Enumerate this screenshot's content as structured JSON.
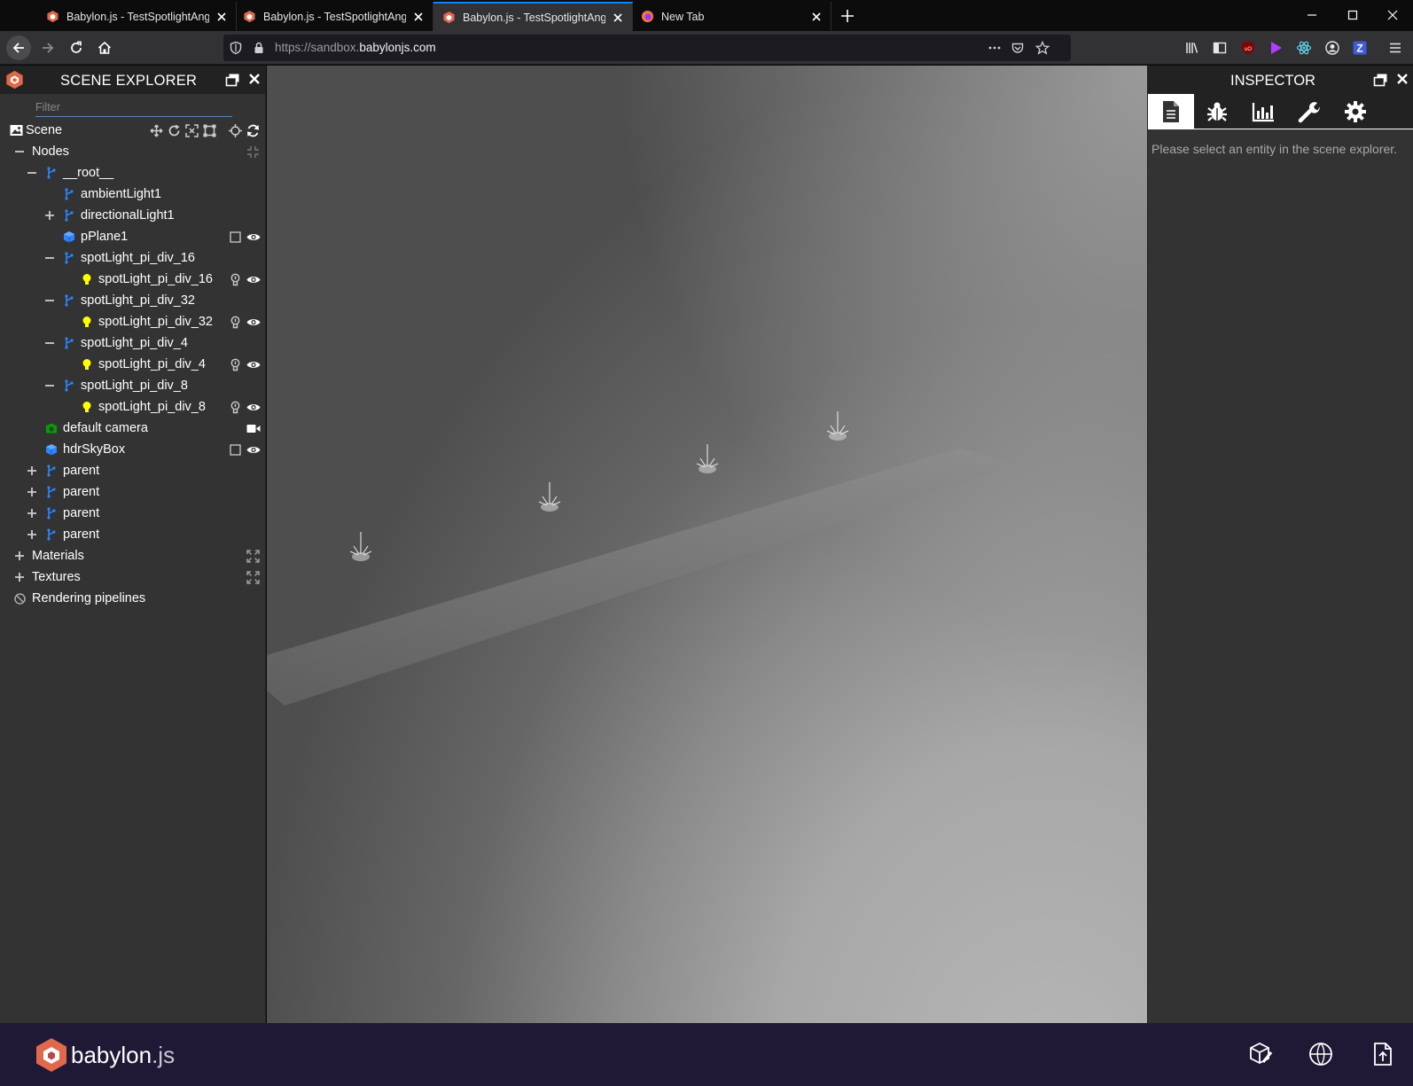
{
  "browser": {
    "tabs": [
      {
        "title": "Babylon.js - TestSpotlightAngle",
        "active": false
      },
      {
        "title": "Babylon.js - TestSpotlightAngle",
        "active": false
      },
      {
        "title": "Babylon.js - TestSpotlightAngle",
        "active": true
      },
      {
        "title": "New Tab",
        "active": false
      }
    ],
    "url_prefix": "https://sandbox.",
    "url_host": "babylonjs.com"
  },
  "scene_explorer": {
    "title": "SCENE EXPLORER",
    "filter_placeholder": "Filter",
    "scene_label": "Scene",
    "nodes": [
      {
        "label": "Nodes"
      },
      {
        "label": "__root__"
      },
      {
        "label": "ambientLight1"
      },
      {
        "label": "directionalLight1"
      },
      {
        "label": "pPlane1"
      },
      {
        "label": "spotLight_pi_div_16"
      },
      {
        "label": "spotLight_pi_div_16"
      },
      {
        "label": "spotLight_pi_div_32"
      },
      {
        "label": "spotLight_pi_div_32"
      },
      {
        "label": "spotLight_pi_div_4"
      },
      {
        "label": "spotLight_pi_div_4"
      },
      {
        "label": "spotLight_pi_div_8"
      },
      {
        "label": "spotLight_pi_div_8"
      },
      {
        "label": "default camera"
      },
      {
        "label": "hdrSkyBox"
      },
      {
        "label": "parent"
      },
      {
        "label": "parent"
      },
      {
        "label": "parent"
      },
      {
        "label": "parent"
      },
      {
        "label": "Materials"
      },
      {
        "label": "Textures"
      },
      {
        "label": "Rendering pipelines"
      }
    ]
  },
  "inspector": {
    "title": "INSPECTOR",
    "tabs": [
      "properties-icon",
      "debug-icon",
      "statistics-icon",
      "tools-icon",
      "settings-icon"
    ],
    "empty_message": "Please select an entity in the scene explorer."
  },
  "footer": {
    "brand_main": "babylon",
    "brand_suffix": ".js"
  },
  "colors": {
    "accent_blue": "#0a84ff",
    "panel_bg": "#333333",
    "header_bg": "#222222",
    "footer_bg": "#201936",
    "node_icon": "#2c84ff",
    "light_icon": "#ffff00",
    "camera_icon": "#00a000"
  }
}
